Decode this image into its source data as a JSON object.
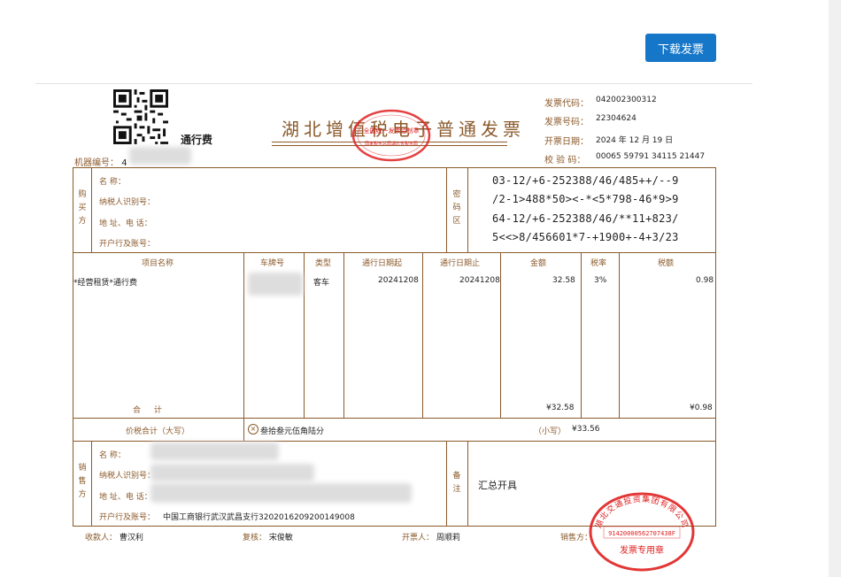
{
  "toolbar": {
    "download_label": "下载发票"
  },
  "invoice": {
    "title": "湖北增值税电子普通发票",
    "subtitle": "通行费",
    "machine_label": "机器编号：",
    "machine_value": "4",
    "meta": [
      {
        "label": "发票代码：",
        "value": "042002300312"
      },
      {
        "label": "发票号码：",
        "value": "22304624"
      },
      {
        "label": "开票日期：",
        "value": "2024 年 12 月 19 日"
      },
      {
        "label": "校 验 码：",
        "value": "00065 59791 34115 21447"
      }
    ],
    "buyer": {
      "side_label": "购买方",
      "name_label": "名 称：",
      "taxid_label": "纳税人识别号：",
      "address_label": "地 址、电 话：",
      "bank_label": "开户行及账号："
    },
    "cipher": {
      "side_label": "密码区",
      "lines": [
        "03-12/+6-252388/46/485++/--9",
        "/2-1>488*50><-*<5*798-46*9>9",
        "64-12/+6-252388/46/**11+823/",
        "5<<>8/456601*7-+1900+-4+3/23"
      ]
    },
    "items_header": [
      "项目名称",
      "车牌号",
      "类型",
      "通行日期起",
      "通行日期止",
      "金额",
      "税率",
      "税额"
    ],
    "item": {
      "name": "*经营租赁*通行费",
      "type": "客车",
      "date_start": "20241208",
      "date_end": "20241208",
      "amount": "32.58",
      "rate": "3%",
      "tax": "0.98"
    },
    "total_label": "合 计",
    "total_amount": "¥32.58",
    "total_tax": "¥0.98",
    "grand_total_label": "价税合计（大写）",
    "grand_total_text": "叁拾叁元伍角陆分",
    "grand_total_small_label": "（小写）",
    "grand_total_small": "¥33.56",
    "seller": {
      "side_label": "销售方",
      "name_label": "名 称：",
      "taxid_label": "纳税人识别号：",
      "address_label": "地 址、电 话：",
      "bank_label": "开户行及账号：",
      "bank_value": "中国工商银行武汉武昌支行3202016209200149008"
    },
    "remarks": {
      "side_label": "备注",
      "value": "汇总开具"
    },
    "footer": {
      "payee_label": "收款人：",
      "payee": "曹汉利",
      "reviewer_label": "复核：",
      "reviewer": "宋俊敏",
      "issuer_label": "开票人：",
      "issuer": "周顺莉",
      "seller_label": "销售方："
    },
    "stamp_top_text": "国家税务总局湖北省税务局",
    "seller_stamp": {
      "name": "湖北交通投资集团有限公司",
      "taxid": "91420000562707438F",
      "caption": "发票专用章"
    }
  },
  "colors": {
    "accent": "#1677c9",
    "frame": "#8b5a2b",
    "stamp": "#e02020"
  }
}
